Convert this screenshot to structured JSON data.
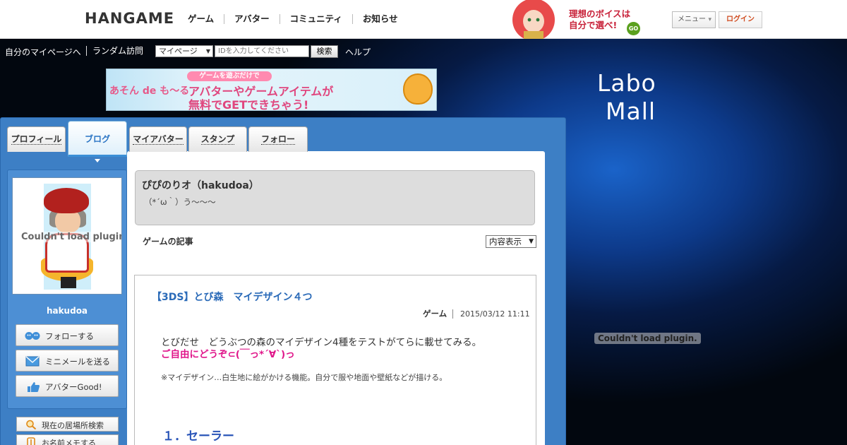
{
  "header": {
    "logo": "HANGAME",
    "nav": [
      "ゲーム",
      "アバター",
      "コミュニティ",
      "お知らせ"
    ],
    "promo_line1": "理想のボイスは",
    "promo_line2": "自分で選べ!",
    "promo_go": "GO",
    "menu_label": "メニュー",
    "login_label": "ログイン"
  },
  "subnav": {
    "mypage": "自分のマイページへ",
    "random": "ランダム訪問",
    "select_value": "マイページ",
    "input_placeholder": "IDを入力してください",
    "search_label": "検索",
    "help": "ヘルプ"
  },
  "banner": {
    "left_text": "あそん de も〜る",
    "tag": "ゲームを遊ぶだけで",
    "line1": "アバターやゲームアイテムが",
    "line2": "無料でGETできちゃう!"
  },
  "labo": {
    "line1": "Labo",
    "line2": "Mall"
  },
  "plugin_error": "Couldn't load plugin.",
  "tabs": [
    {
      "label": "プロフィール",
      "active": false
    },
    {
      "label": "ブログ",
      "active": true
    },
    {
      "label": "マイアバター",
      "active": false
    },
    {
      "label": "スタンプ",
      "active": false
    },
    {
      "label": "フォロー",
      "active": false
    }
  ],
  "sidebar": {
    "username": "hakudoa",
    "buttons": [
      "フォローする",
      "ミニメールを送る",
      "アバターGood!"
    ],
    "links": [
      "現在の居場所検索",
      "お名前メモする"
    ]
  },
  "profile": {
    "name": "ぴぴのりオ（hakudoa）",
    "message": "（*´ω｀）う〜〜〜"
  },
  "category_label": "ゲームの記事",
  "view_select": "内容表示",
  "article": {
    "title": "【3DS】とび森　マイデザイン４つ",
    "category": "ゲーム",
    "date": "2015/03/12 11:11",
    "p1": "とびだせ　どうぶつの森のマイデザイン4種をテストがてらに載せてみる。",
    "p2": "ご自由にどうぞ⊂(￣っ*´∀`)っ",
    "p3": "※マイデザイン…白生地に絵がかける機能。自分で服や地面や壁紙などが描ける。",
    "heading": "１．セーラー"
  },
  "colors": {
    "accent_blue": "#2a74c4",
    "panel_blue": "#3d7fc5",
    "pink": "#e0168a",
    "login_orange": "#d04b1f"
  }
}
